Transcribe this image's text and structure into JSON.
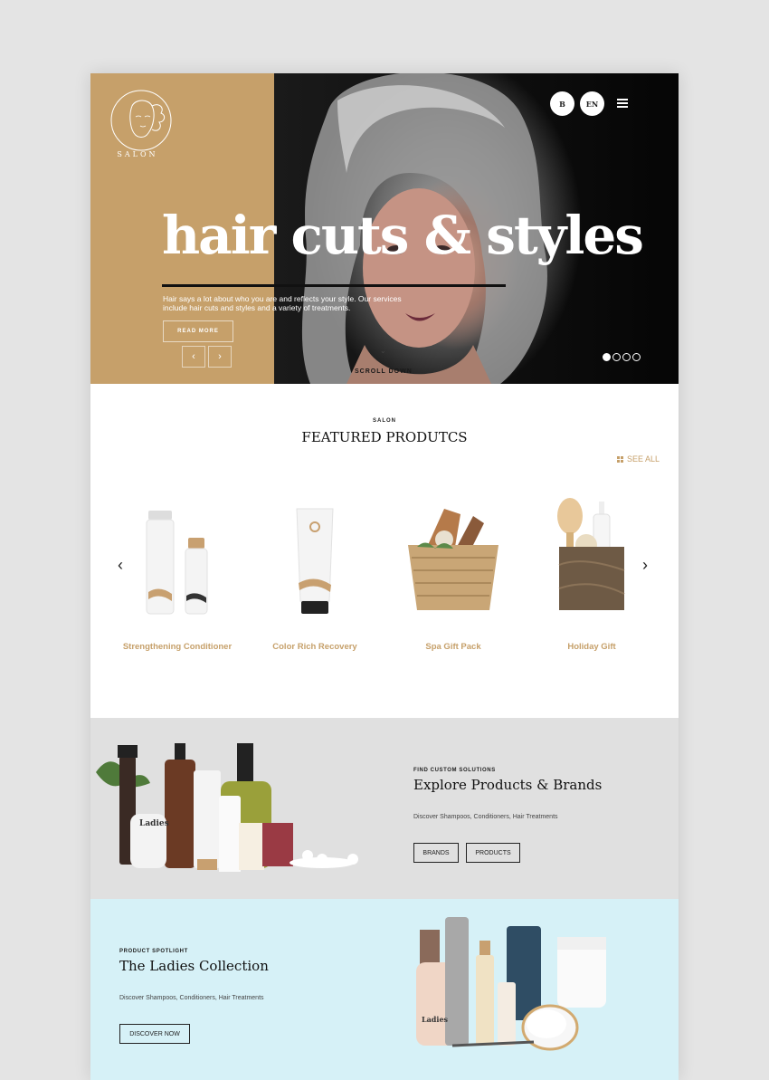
{
  "header": {
    "logo_text": "SALON",
    "lang_b": "B",
    "lang_en": "EN"
  },
  "hero": {
    "title": "hair cuts & styles",
    "description": "Hair says a lot about who you are and reflects your style. Our services include hair cuts and styles and a variety of treatments.",
    "read_more": "READ MORE",
    "scroll_down": "SCROLL DOWN",
    "slide_count": 4,
    "active_slide": 1
  },
  "featured": {
    "kicker": "SALON",
    "title": "FEATURED PRODUTCS",
    "see_all": "SEE ALL",
    "products": [
      {
        "name": "Strengthening Conditioner"
      },
      {
        "name": "Color Rich Recovery"
      },
      {
        "name": "Spa Gift Pack"
      },
      {
        "name": "Holiday Gift"
      }
    ]
  },
  "explore": {
    "kicker": "FIND CUSTOM SOLUTIONS",
    "title": "Explore Products & Brands",
    "description": "Discover Shampoos, Conditioners, Hair Treatments",
    "buttons": [
      "BRANDS",
      "PRODUCTS"
    ],
    "label_brand": "Ladies"
  },
  "ladies": {
    "kicker": "PRODUCT SPOTLIGHT",
    "title": "The Ladies Collection",
    "description": "Discover Shampoos, Conditioners, Hair Treatments",
    "button": "DISCOVER NOW",
    "label_brand": "Ladies"
  },
  "colors": {
    "accent": "#c6a06a",
    "dark": "#111111",
    "explore_bg": "#e0e0e0",
    "ladies_bg": "#d6f1f7"
  }
}
